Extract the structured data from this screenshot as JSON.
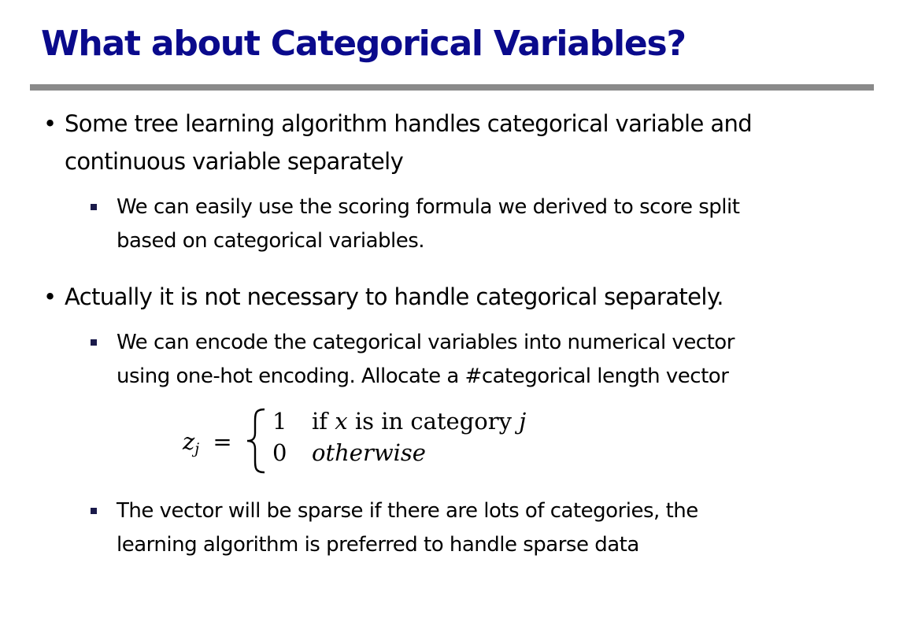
{
  "slide": {
    "title": "What about Categorical Variables?",
    "bullets": [
      {
        "lines": [
          "Some tree learning algorithm handles categorical variable and",
          "continuous variable separately"
        ],
        "subs": [
          {
            "lines": [
              "We can easily use the scoring formula we derived to score split",
              "based on categorical variables."
            ]
          }
        ]
      },
      {
        "lines": [
          "Actually it is not necessary to handle categorical separately."
        ],
        "subs": [
          {
            "lines": [
              "We can encode the categorical variables into numerical vector",
              "using one-hot encoding. Allocate a #categorical length vector"
            ]
          },
          {
            "lines": [
              "The vector will be sparse if there are lots of categories, the",
              "learning algorithm is preferred to handle sparse data"
            ]
          }
        ]
      }
    ],
    "formula": {
      "lhs_var": "z",
      "lhs_sub": "j",
      "equals": "=",
      "case1_value": "1",
      "case1_if": "if",
      "case1_var": "x",
      "case1_text": "is in category",
      "case1_cat": "j",
      "case2_value": "0",
      "case2_text": "otherwise"
    }
  }
}
